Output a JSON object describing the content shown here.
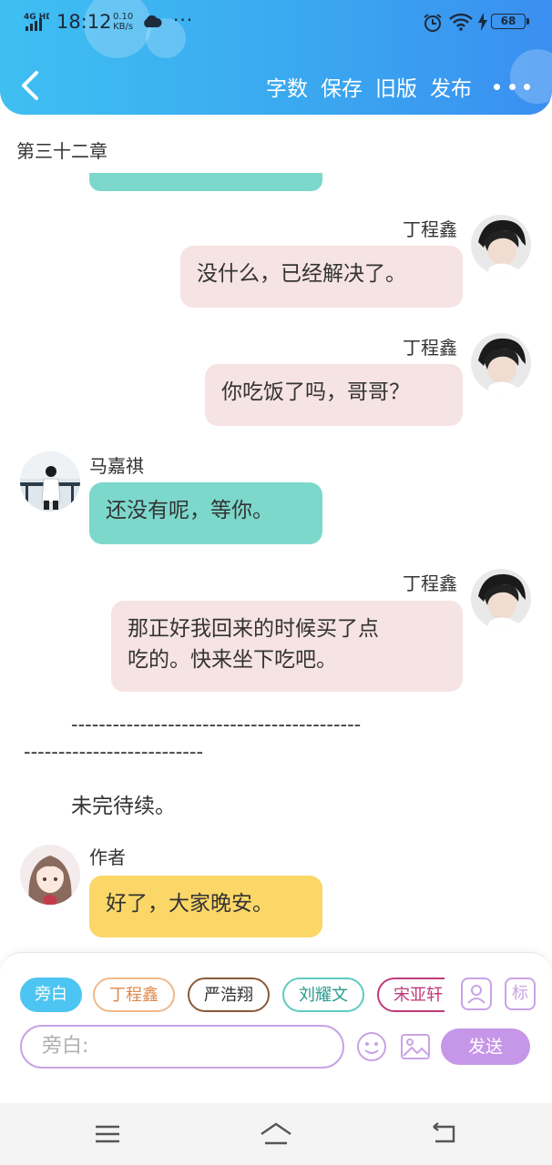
{
  "status_bar": {
    "network": "4G HD",
    "time": "18:12",
    "speed_value": "0.10",
    "speed_unit": "KB/s",
    "more": "···",
    "battery": "68"
  },
  "toolbar": {
    "word_count": "字数",
    "save": "保存",
    "old_version": "旧版",
    "publish": "发布"
  },
  "chapter_title": "第三十二章",
  "messages": [
    {
      "name": "丁程鑫",
      "text": "没什么，已经解决了。"
    },
    {
      "name": "丁程鑫",
      "text": "你吃饭了吗，哥哥？"
    },
    {
      "name": "马嘉祺",
      "text": "还没有呢，等你。"
    },
    {
      "name": "丁程鑫",
      "line1": "那正好我回来的时候买了点",
      "line2": "吃的。快来坐下吃吧。"
    },
    {
      "name": "作者",
      "text": "好了，大家晚安。"
    }
  ],
  "separator": {
    "line1": "------------------------------------------",
    "line2": "--------------------------"
  },
  "narration": "未完待续。",
  "composer": {
    "chips": [
      "旁白",
      "丁程鑫",
      "严浩翔",
      "刘耀文",
      "宋亚轩"
    ],
    "tag_button": "标",
    "input_placeholder": "旁白:",
    "send": "发送"
  },
  "colors": {
    "header": "#3aa8f0",
    "pink_bubble": "#f6e3e3",
    "teal_bubble": "#7dd8cc",
    "yellow_bubble": "#fbd768",
    "accent_purple": "#c697e8"
  }
}
